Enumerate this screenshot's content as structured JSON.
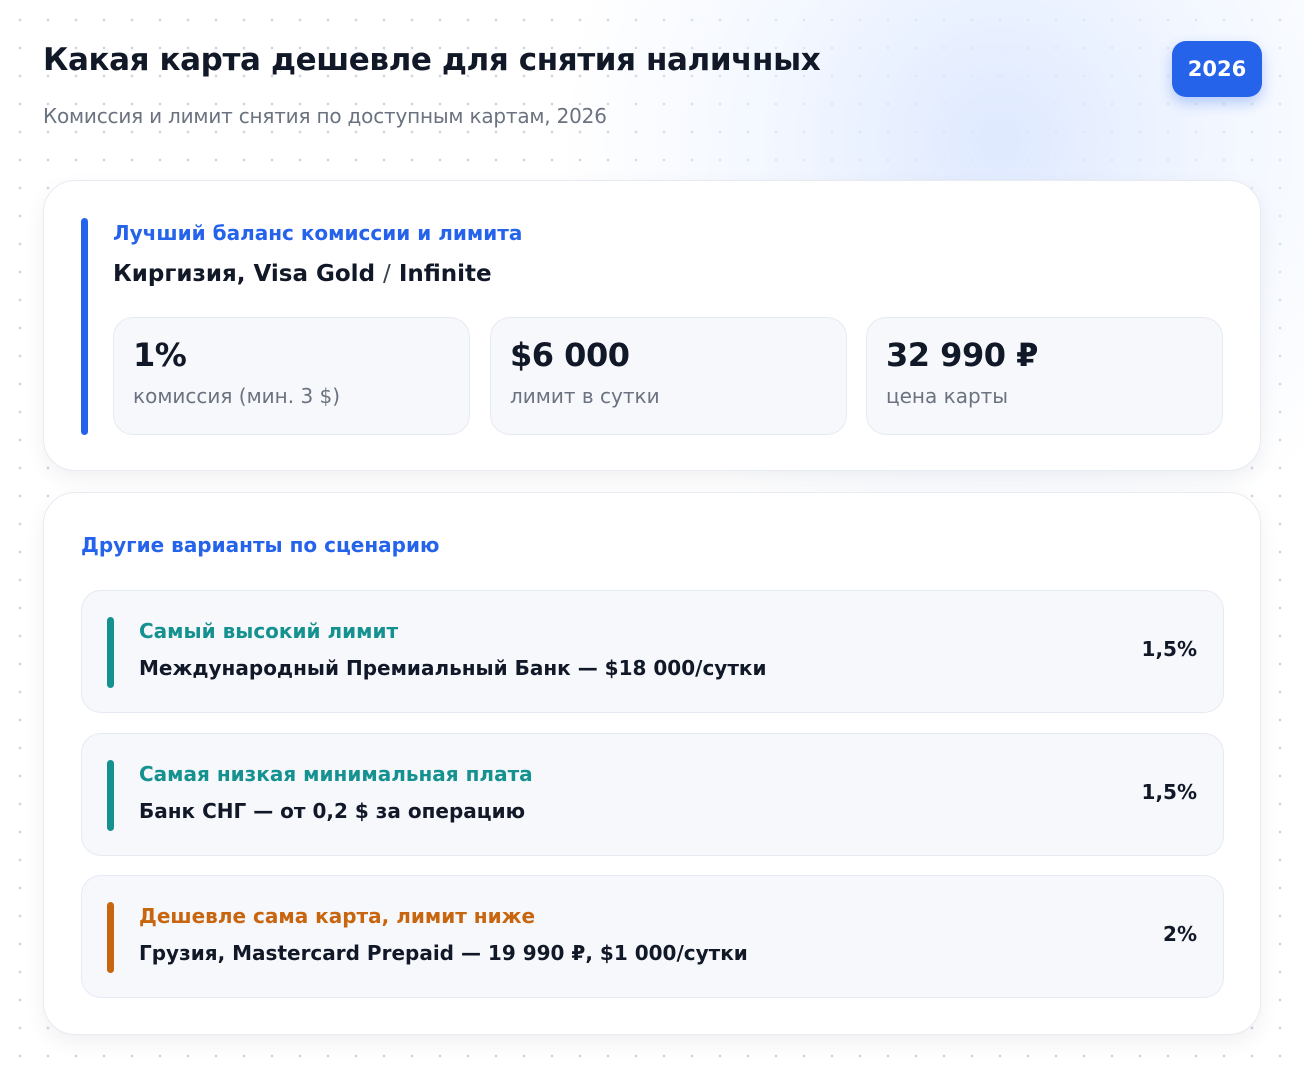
{
  "header": {
    "title": "Какая карта дешевле для снятия наличных",
    "subtitle": "Комиссия и лимит снятия по доступным картам, 2026",
    "year_badge": "2026"
  },
  "best": {
    "label": "Лучший баланс комиссии и лимита",
    "name_part1": "Киргизия, Visa Gold",
    "separator": "/",
    "name_part2": "Infinite",
    "stats": [
      {
        "value": "1%",
        "label": "комиссия (мин. 3 $)"
      },
      {
        "value": "$6 000",
        "label": "лимит в сутки"
      },
      {
        "value": "32 990 ₽",
        "label": "цена карты"
      }
    ]
  },
  "others": {
    "heading": "Другие варианты по сценарию",
    "items": [
      {
        "title": "Самый высокий лимит",
        "desc": "Международный Премиальный Банк — $18 000/сутки",
        "rate": "1,5%",
        "accent": "#15918f"
      },
      {
        "title": "Самая низкая минимальная плата",
        "desc": "Банк СНГ — от 0,2 $ за операцию",
        "rate": "1,5%",
        "accent": "#15918f"
      },
      {
        "title": "Дешевле сама карта, лимит ниже",
        "desc": "Грузия, Mastercard Prepaid — 19 990 ₽, $1 000/сутки",
        "rate": "2%",
        "accent": "#c8650f"
      }
    ]
  },
  "colors": {
    "primary": "#2563eb",
    "teal": "#15918f",
    "orange": "#c8650f"
  }
}
